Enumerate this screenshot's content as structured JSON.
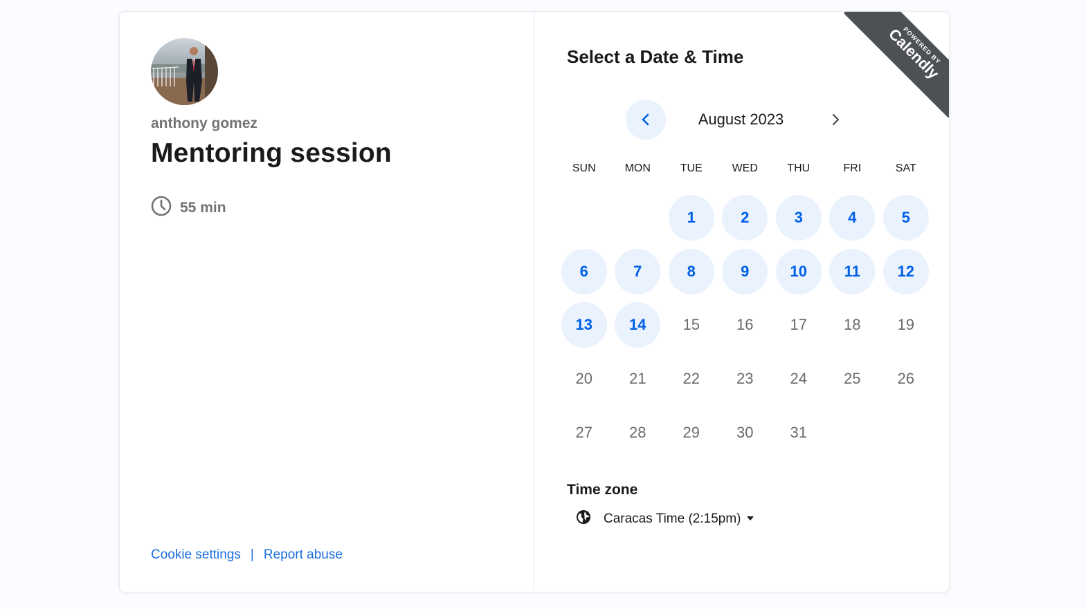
{
  "host": {
    "name": "anthony gomez",
    "avatar_icon": "person-photo"
  },
  "event": {
    "title": "Mentoring session",
    "duration": "55 min",
    "duration_icon": "clock-icon"
  },
  "footer": {
    "cookie_settings": "Cookie settings",
    "separator": "|",
    "report_abuse": "Report abuse"
  },
  "picker": {
    "title": "Select a Date & Time",
    "month": "August 2023",
    "weekdays": [
      "SUN",
      "MON",
      "TUE",
      "WED",
      "THU",
      "FRI",
      "SAT"
    ],
    "first_weekday_index": 2,
    "days": [
      {
        "label": "1",
        "available": true
      },
      {
        "label": "2",
        "available": true
      },
      {
        "label": "3",
        "available": true
      },
      {
        "label": "4",
        "available": true
      },
      {
        "label": "5",
        "available": true
      },
      {
        "label": "6",
        "available": true
      },
      {
        "label": "7",
        "available": true
      },
      {
        "label": "8",
        "available": true
      },
      {
        "label": "9",
        "available": true
      },
      {
        "label": "10",
        "available": true
      },
      {
        "label": "11",
        "available": true
      },
      {
        "label": "12",
        "available": true
      },
      {
        "label": "13",
        "available": true
      },
      {
        "label": "14",
        "available": true
      },
      {
        "label": "15",
        "available": false
      },
      {
        "label": "16",
        "available": false
      },
      {
        "label": "17",
        "available": false
      },
      {
        "label": "18",
        "available": false
      },
      {
        "label": "19",
        "available": false
      },
      {
        "label": "20",
        "available": false
      },
      {
        "label": "21",
        "available": false
      },
      {
        "label": "22",
        "available": false
      },
      {
        "label": "23",
        "available": false
      },
      {
        "label": "24",
        "available": false
      },
      {
        "label": "25",
        "available": false
      },
      {
        "label": "26",
        "available": false
      },
      {
        "label": "27",
        "available": false
      },
      {
        "label": "28",
        "available": false
      },
      {
        "label": "29",
        "available": false
      },
      {
        "label": "30",
        "available": false
      },
      {
        "label": "31",
        "available": false
      }
    ]
  },
  "timezone": {
    "label": "Time zone",
    "value": "Caracas Time (2:15pm)",
    "icon": "globe-icon"
  },
  "badge": {
    "powered_by": "POWERED BY",
    "brand": "Calendly"
  },
  "colors": {
    "accent": "#0060e6",
    "available_bg": "#eaf2fe",
    "link": "#1a6fe0",
    "badge_bg": "#4d5055"
  }
}
